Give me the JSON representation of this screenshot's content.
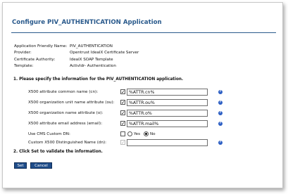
{
  "page": {
    "title": "Configure PIV_AUTHENTICATION Application"
  },
  "info": [
    {
      "label": "Application Friendly Name:",
      "value": "PIV_AUTHENTICATION"
    },
    {
      "label": "Provider:",
      "value": "Opentrust IdealX Certificate Server"
    },
    {
      "label": "Certificate Authority:",
      "value": "IdealX SOAP Template"
    },
    {
      "label": "Template:",
      "value": "ActivIdr- Authentication"
    }
  ],
  "step1": "1. Please specify the information for the PIV_AUTHENTICATION application.",
  "fields": [
    {
      "label": "X500 attribute common name (cn):",
      "value": "%ATTR.cn%",
      "checked": true
    },
    {
      "label": "X500 organization unit name attribute (ou):",
      "value": "%ATTR.ou%",
      "checked": true
    },
    {
      "label": "X500 organization name attribute (o):",
      "value": "%ATTR.o%",
      "checked": true
    },
    {
      "label": "X500 attribute email address (email):",
      "value": "%ATTR.mail%",
      "checked": true
    }
  ],
  "cms_custom_dn": {
    "label": "Use CMS Custom DN:",
    "yes_label": "Yes",
    "no_label": "No",
    "selected": "No"
  },
  "custom_dn": {
    "label": "Custom X500 Distinguished Name (dn):",
    "value": ""
  },
  "step2": "2. Click Set to validate the information.",
  "buttons": {
    "set": "Set",
    "cancel": "Cancel"
  },
  "icons": {
    "help": "help-icon",
    "check": "checkmark-icon"
  },
  "colors": {
    "title": "#2a5a8c",
    "button": "#1f4d8a",
    "help": "#2d5fc4"
  }
}
